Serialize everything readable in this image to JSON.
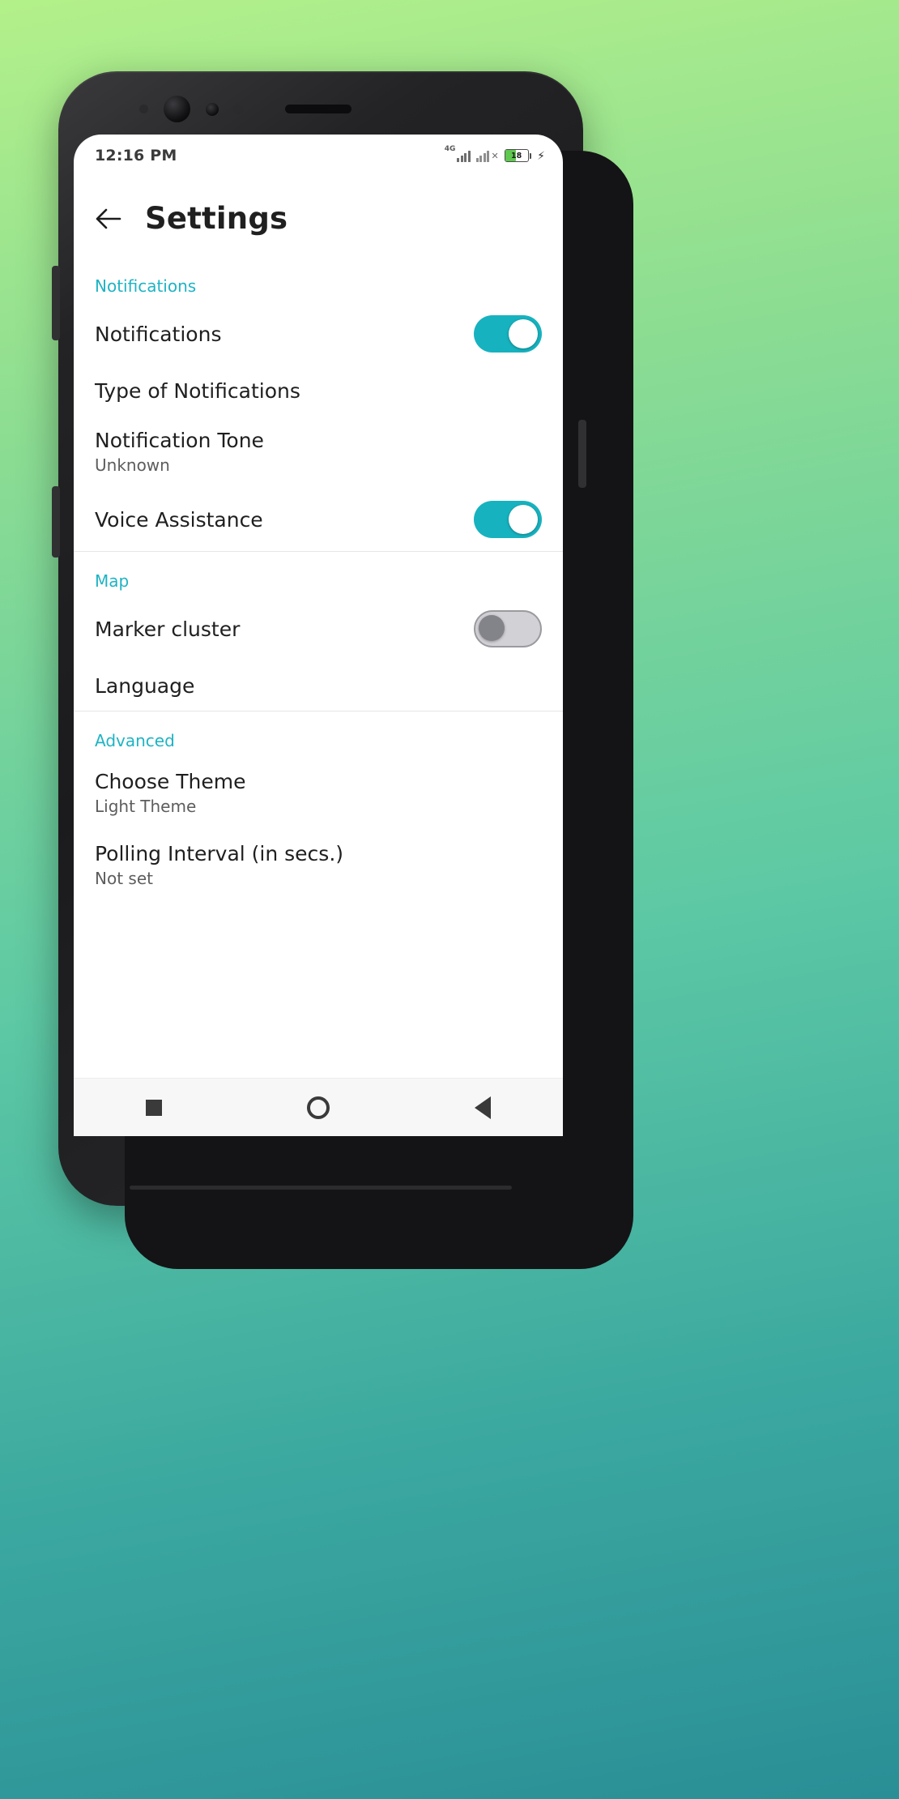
{
  "status_bar": {
    "clock": "12:16 PM",
    "network_tag": "4G",
    "battery_level": "18",
    "charging_icon": "lightning-bolt-icon",
    "signal_icon": "signal-bars-icon",
    "signal_icon_2": "signal-bars-no-sim-icon"
  },
  "appbar": {
    "back_icon": "arrow-left-icon",
    "title": "Settings"
  },
  "sections": [
    {
      "title": "Notifications",
      "rows": [
        {
          "label": "Notifications",
          "sub": "",
          "control": "toggle",
          "state": "on"
        },
        {
          "label": "Type of Notifications",
          "sub": "",
          "control": "none",
          "state": ""
        },
        {
          "label": "Notification Tone",
          "sub": "Unknown",
          "control": "none",
          "state": ""
        },
        {
          "label": "Voice Assistance",
          "sub": "",
          "control": "toggle",
          "state": "on"
        }
      ]
    },
    {
      "title": "Map",
      "rows": [
        {
          "label": "Marker cluster",
          "sub": "",
          "control": "toggle",
          "state": "off"
        },
        {
          "label": "Language",
          "sub": "",
          "control": "none",
          "state": ""
        }
      ]
    },
    {
      "title": "Advanced",
      "rows": [
        {
          "label": "Choose Theme",
          "sub": "Light Theme",
          "control": "none",
          "state": ""
        },
        {
          "label": "Polling Interval (in secs.)",
          "sub": "Not set",
          "control": "none",
          "state": ""
        }
      ]
    }
  ],
  "navbar": {
    "recent_icon": "square-recents-icon",
    "home_icon": "circle-home-icon",
    "back_icon": "triangle-back-icon"
  },
  "colors": {
    "accent": "#1fb3c4",
    "toggle_on": "#17b2bf",
    "toggle_off": "#d2d2d6",
    "battery_green": "#5ec84f"
  }
}
